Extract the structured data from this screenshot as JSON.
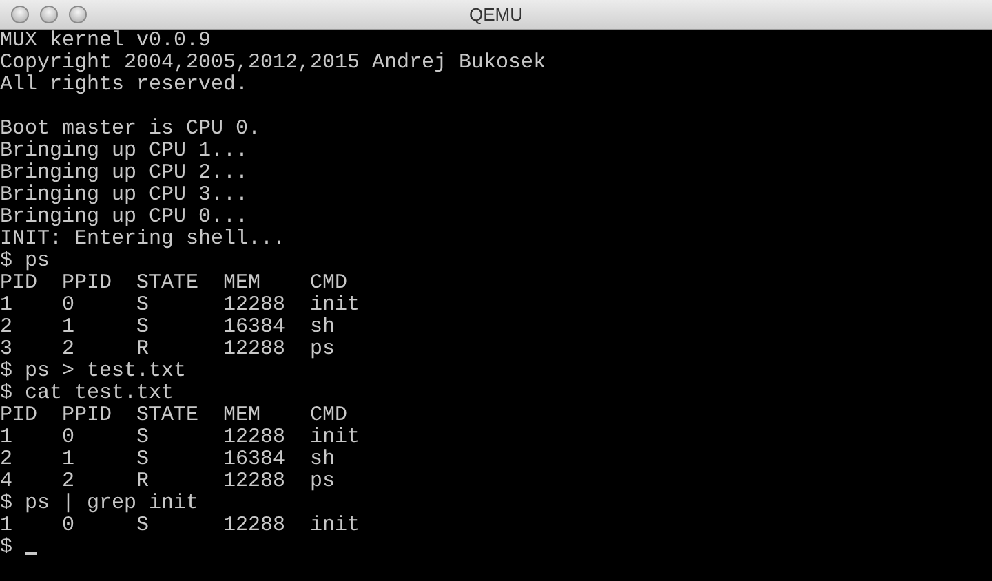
{
  "window": {
    "title": "QEMU"
  },
  "terminal": {
    "blocks": [
      [
        "MUX kernel v0.0.9",
        "Copyright 2004,2005,2012,2015 Andrej Bukosek",
        "All rights reserved."
      ],
      [
        "Boot master is CPU 0.",
        "Bringing up CPU 1...",
        "Bringing up CPU 2...",
        "Bringing up CPU 3...",
        "Bringing up CPU 0...",
        "INIT: Entering shell...",
        "$ ps",
        "PID  PPID  STATE  MEM    CMD",
        "1    0     S      12288  init",
        "2    1     S      16384  sh",
        "3    2     R      12288  ps",
        "$ ps > test.txt",
        "$ cat test.txt",
        "PID  PPID  STATE  MEM    CMD",
        "1    0     S      12288  init",
        "2    1     S      16384  sh",
        "4    2     R      12288  ps",
        "$ ps | grep init",
        "1    0     S      12288  init"
      ]
    ],
    "prompt": "$",
    "cursor": true
  }
}
